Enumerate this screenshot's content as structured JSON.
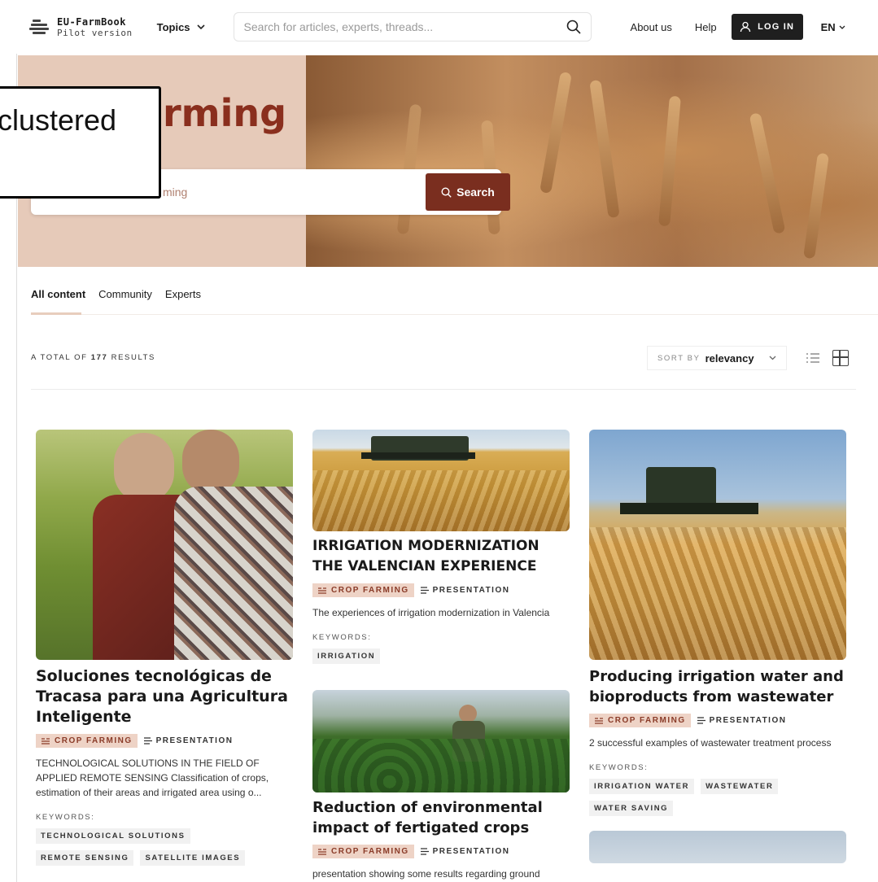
{
  "header": {
    "logo_title": "EU-FarmBook",
    "logo_subtitle": "Pilot version",
    "topics_label": "Topics",
    "search_placeholder": "Search for articles, experts, threads...",
    "about_label": "About us",
    "help_label": "Help",
    "login_label": "LOG IN",
    "lang_label": "EN"
  },
  "hero": {
    "title": "rming",
    "search_value": "ming",
    "search_button": "Search"
  },
  "overlay": {
    "text": "clustered"
  },
  "tabs": [
    {
      "label": "All content",
      "active": true
    },
    {
      "label": "Community",
      "active": false
    },
    {
      "label": "Experts",
      "active": false
    }
  ],
  "results": {
    "prefix": "A TOTAL OF",
    "count": "177",
    "suffix": "RESULTS",
    "sort_label": "SORT BY",
    "sort_value": "relevancy"
  },
  "cards": [
    {
      "title": "Soluciones tecnológicas de Tracasa para una Agricultura Inteligente",
      "category": "CROP FARMING",
      "type": "PRESENTATION",
      "description": "TECHNOLOGICAL SOLUTIONS IN THE FIELD OF APPLIED REMOTE SENSING Classification of crops, estimation of their areas and irrigated area using o...",
      "keywords_label": "KEYWORDS:",
      "keywords": [
        "TECHNOLOGICAL SOLUTIONS",
        "REMOTE SENSING",
        "SATELLITE IMAGES"
      ]
    },
    {
      "title": "IRRIGATION MODERNIZATION THE VALENCIAN EXPERIENCE",
      "category": "CROP FARMING",
      "type": "PRESENTATION",
      "description": "The experiences of irrigation modernization in Valencia",
      "keywords_label": "KEYWORDS:",
      "keywords": [
        "IRRIGATION"
      ]
    },
    {
      "title": "Producing irrigation water and bioproducts from wastewater",
      "category": "CROP FARMING",
      "type": "PRESENTATION",
      "description": "2 successful examples of wastewater treatment process",
      "keywords_label": "KEYWORDS:",
      "keywords": [
        "IRRIGATION WATER",
        "WASTEWATER",
        "WATER SAVING"
      ]
    },
    {
      "title": "Reduction of environmental impact of fertigated crops",
      "category": "CROP FARMING",
      "type": "PRESENTATION",
      "description": "presentation showing some results regarding ground"
    }
  ]
}
